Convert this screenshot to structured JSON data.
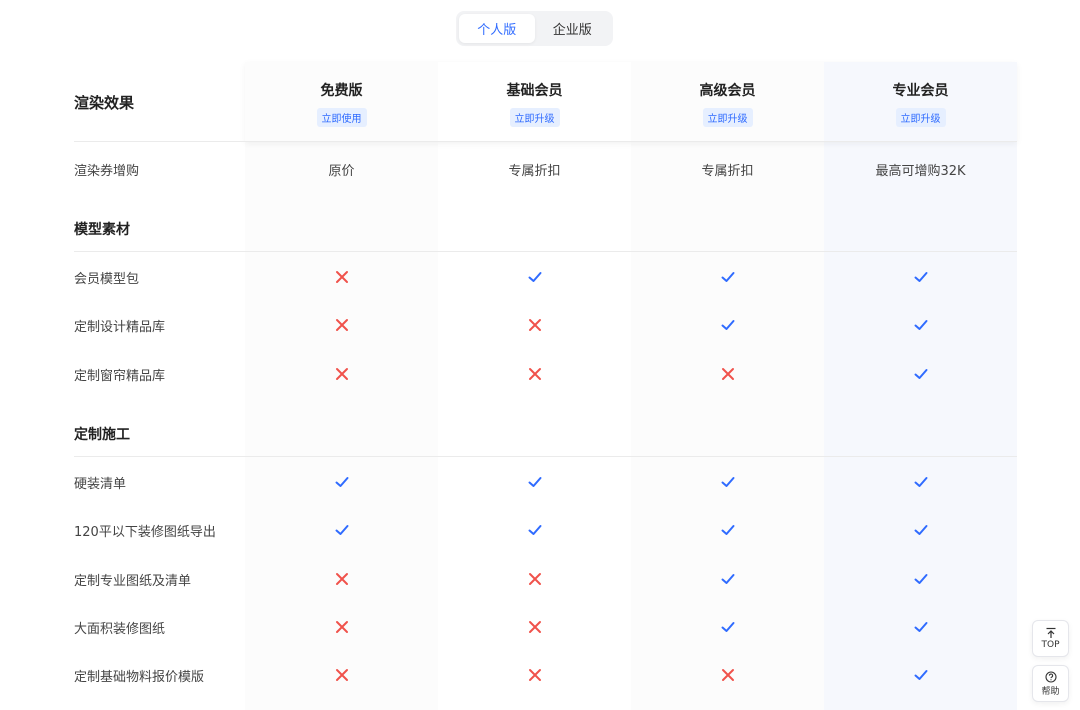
{
  "tabs": [
    {
      "label": "个人版",
      "active": true
    },
    {
      "label": "企业版",
      "active": false
    }
  ],
  "header": {
    "feature_label": "渲染效果",
    "plans": [
      {
        "name": "免费版",
        "action": "立即使用"
      },
      {
        "name": "基础会员",
        "action": "立即升级"
      },
      {
        "name": "高级会员",
        "action": "立即升级"
      },
      {
        "name": "专业会员",
        "action": "立即升级"
      }
    ]
  },
  "rows": {
    "render_voucher": {
      "label": "渲染券增购",
      "values": [
        "原价",
        "专属折扣",
        "专属折扣",
        "最高可增购32K"
      ]
    }
  },
  "sections": [
    {
      "title": "模型素材",
      "items": [
        {
          "label": "会员模型包",
          "values": [
            false,
            true,
            true,
            true
          ]
        },
        {
          "label": "定制设计精品库",
          "values": [
            false,
            false,
            true,
            true
          ]
        },
        {
          "label": "定制窗帘精品库",
          "values": [
            false,
            false,
            false,
            true
          ]
        }
      ]
    },
    {
      "title": "定制施工",
      "items": [
        {
          "label": "硬装清单",
          "values": [
            true,
            true,
            true,
            true
          ]
        },
        {
          "label": "120平以下装修图纸导出",
          "values": [
            true,
            true,
            true,
            true
          ]
        },
        {
          "label": "定制专业图纸及清单",
          "values": [
            false,
            false,
            true,
            true
          ]
        },
        {
          "label": "大面积装修图纸",
          "values": [
            false,
            false,
            true,
            true
          ]
        },
        {
          "label": "定制基础物料报价模版",
          "values": [
            false,
            false,
            false,
            true
          ]
        }
      ]
    }
  ],
  "icons": {
    "included": "check-icon",
    "excluded": "cross-icon",
    "top": "arrow-up-icon",
    "help": "question-circle-icon"
  },
  "colors": {
    "accent": "#2f6bff",
    "check": "#2f6bff",
    "cross": "#f0524b",
    "pro_column": "#f6f8fd"
  },
  "floating": {
    "top_label": "TOP",
    "help_label": "帮助"
  }
}
